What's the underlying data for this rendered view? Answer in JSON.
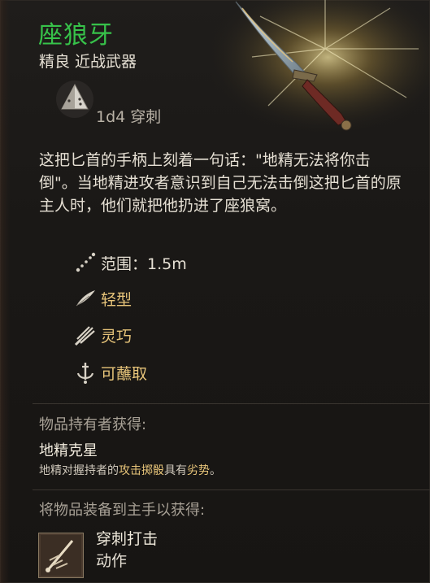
{
  "item": {
    "name": "座狼牙",
    "rarity_type": "精良 近战武器",
    "damage": "1d4 穿刺",
    "description": "这把匕首的手柄上刻着一句话：\"地精无法将你击倒\"。当地精进攻者意识到自己无法击倒这把匕首的原主人时，他们就把他扔进了座狼窝。",
    "icons": {
      "die": "d4-die-icon",
      "knife": "dagger-art"
    }
  },
  "properties": [
    {
      "label": "范围：1.5m",
      "icon": "range-icon"
    },
    {
      "label": "轻型",
      "icon": "feather-icon"
    },
    {
      "label": "灵巧",
      "icon": "finesse-icon"
    },
    {
      "label": "可蘸取",
      "icon": "dippable-icon"
    }
  ],
  "wielder": {
    "heading": "物品持有者获得:",
    "name": "地精克星",
    "desc_pre": "地精对握持者的",
    "desc_hl": "攻击掷骰",
    "desc_post": "具有",
    "desc_hl2": "劣势",
    "desc_end": "。"
  },
  "equip": {
    "heading": "将物品装备到主手以获得:",
    "action_name": "穿刺打击",
    "action_type": "动作",
    "action_icon": "piercing-strike-icon"
  },
  "colors": {
    "rarity_green": "#37c24a",
    "keyword_gold": "#e8c57a",
    "text": "#e6e0d4",
    "muted": "#a8a196"
  }
}
